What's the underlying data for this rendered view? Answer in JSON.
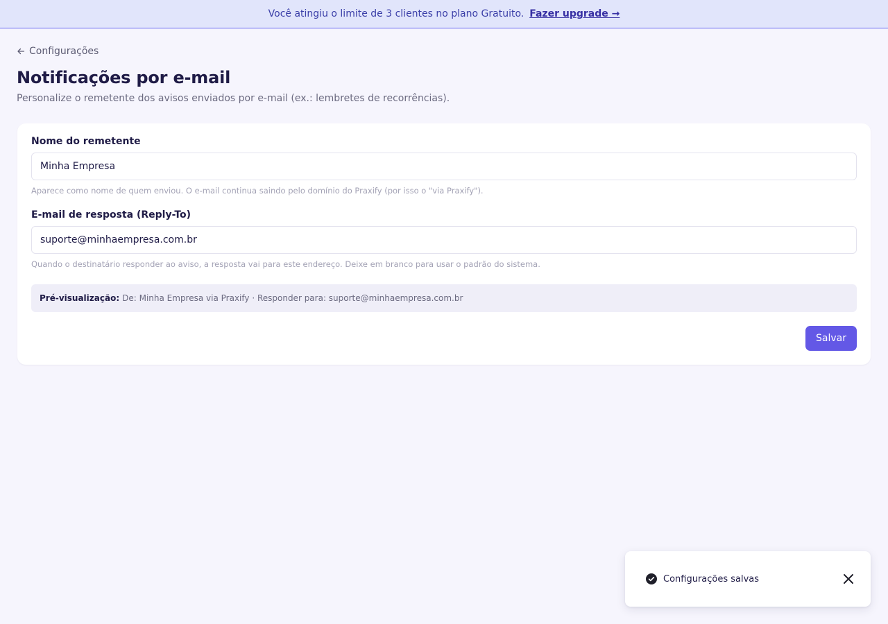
{
  "banner": {
    "message": "Você atingiu o limite de 3 clientes no plano Gratuito.",
    "upgrade_link": "Fazer upgrade →"
  },
  "nav": {
    "back_label": "Configurações",
    "back_icon": "arrow-left-icon"
  },
  "page": {
    "title": "Notificações por e-mail",
    "subtitle": "Personalize o remetente dos avisos enviados por e-mail (ex.: lembretes de recorrências)."
  },
  "form": {
    "sender_name": {
      "label": "Nome do remetente",
      "value": "Minha Empresa",
      "hint": "Aparece como nome de quem enviou. O e-mail continua saindo pelo domínio do Praxify (por isso o \"via Praxify\")."
    },
    "reply_to": {
      "label": "E-mail de resposta (Reply-To)",
      "value": "suporte@minhaempresa.com.br",
      "hint": "Quando o destinatário responder ao aviso, a resposta vai para este endereço. Deixe em branco para usar o padrão do sistema."
    },
    "preview": {
      "label": "Pré-visualização:",
      "text": "De: Minha Empresa via Praxify · Responder para: suporte@minhaempresa.com.br"
    },
    "save_label": "Salvar"
  },
  "toast": {
    "message": "Configurações salvas",
    "icon": "check-circle-icon",
    "close_icon": "close-icon"
  },
  "colors": {
    "accent": "#6358e6",
    "banner_bg": "#e1e5fb",
    "page_bg": "#f6f5fd"
  }
}
